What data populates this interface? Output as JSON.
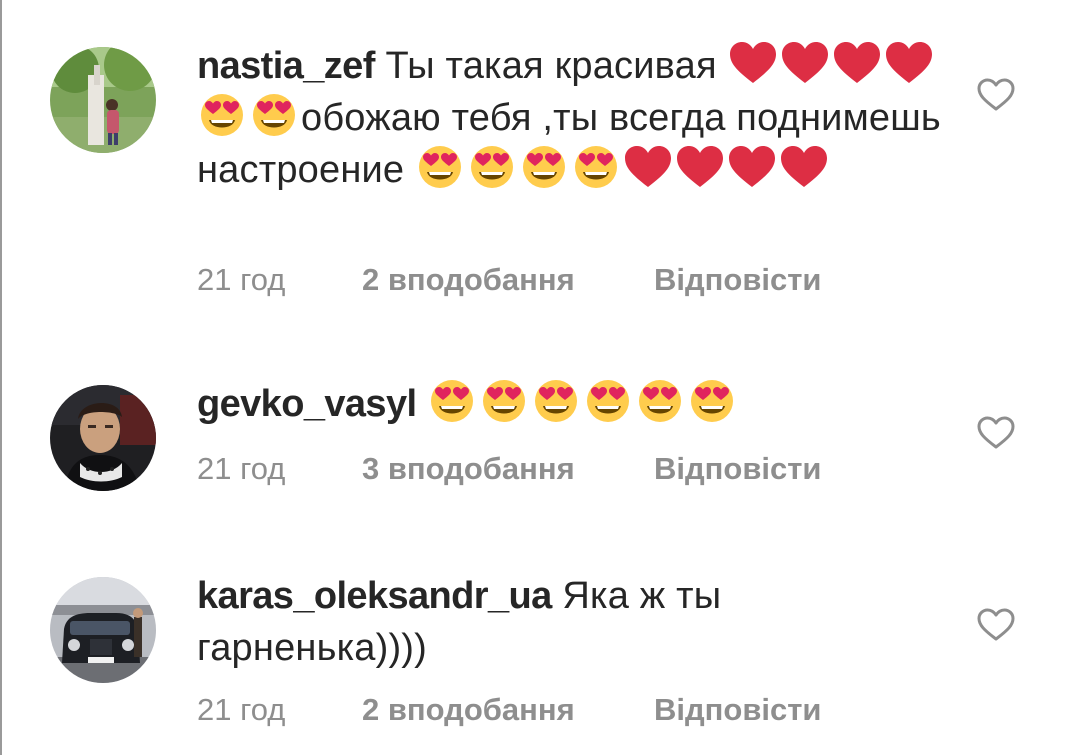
{
  "comments": [
    {
      "username": "nastia_zef",
      "segments": [
        {
          "type": "text",
          "value": "Ты такая красивая "
        },
        {
          "type": "emoji",
          "value": "red-heart"
        },
        {
          "type": "emoji",
          "value": "red-heart"
        },
        {
          "type": "emoji",
          "value": "red-heart"
        },
        {
          "type": "emoji",
          "value": "red-heart"
        },
        {
          "type": "emoji",
          "value": "heart-eyes"
        },
        {
          "type": "emoji",
          "value": "heart-eyes"
        },
        {
          "type": "text",
          "value": "обожаю тебя ,ты всегда поднимешь настроение "
        },
        {
          "type": "emoji",
          "value": "heart-eyes"
        },
        {
          "type": "emoji",
          "value": "heart-eyes"
        },
        {
          "type": "emoji",
          "value": "heart-eyes"
        },
        {
          "type": "emoji",
          "value": "heart-eyes"
        },
        {
          "type": "emoji",
          "value": "red-heart"
        },
        {
          "type": "emoji",
          "value": "red-heart"
        },
        {
          "type": "emoji",
          "value": "red-heart"
        },
        {
          "type": "emoji",
          "value": "red-heart"
        }
      ],
      "time": "21 год",
      "likes": "2 вподобання",
      "reply": "Відповісти",
      "avatar": "avatar-park-photo"
    },
    {
      "username": "gevko_vasyl",
      "segments": [
        {
          "type": "text",
          "value": " "
        },
        {
          "type": "emoji",
          "value": "heart-eyes"
        },
        {
          "type": "emoji",
          "value": "heart-eyes"
        },
        {
          "type": "emoji",
          "value": "heart-eyes"
        },
        {
          "type": "emoji",
          "value": "heart-eyes"
        },
        {
          "type": "emoji",
          "value": "heart-eyes"
        },
        {
          "type": "emoji",
          "value": "heart-eyes"
        }
      ],
      "time": "21 год",
      "likes": "3 вподобання",
      "reply": "Відповісти",
      "avatar": "avatar-man-portrait"
    },
    {
      "username": "karas_oleksandr_ua",
      "segments": [
        {
          "type": "text",
          "value": " Яка ж ты гарненька))))"
        }
      ],
      "time": "21 год",
      "likes": "2 вподобання",
      "reply": "Відповісти",
      "avatar": "avatar-black-car"
    }
  ],
  "colors": {
    "text": "#262626",
    "meta": "#8e8e8e",
    "heart_outline": "#8e8e8e",
    "emoji_heart_red": "#dd2e44",
    "emoji_face_yellow": "#ffcc4d"
  },
  "icons": {
    "like": "heart-outline-icon"
  }
}
